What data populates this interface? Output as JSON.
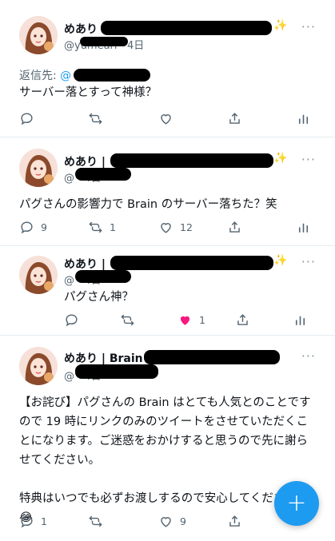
{
  "tweets": [
    {
      "name": "めあり",
      "handle": "@yumeari",
      "time": "4日",
      "reply_label": "返信先:",
      "reply_mention": "@",
      "text": "サーバー落とすって神様？",
      "counts": {
        "reply": "",
        "retweet": "",
        "like": ""
      },
      "liked": false
    },
    {
      "name": "めあり |",
      "handle": "@",
      "time": "4日",
      "text": "パグさんの影響力で Brain のサーバー落ちた？笑",
      "counts": {
        "reply": "9",
        "retweet": "1",
        "like": "12"
      },
      "liked": false
    },
    {
      "name": "めあり |",
      "handle": "@",
      "time": "4日",
      "text": "パグさん神？",
      "counts": {
        "reply": "",
        "retweet": "",
        "like": "1"
      },
      "liked": true
    },
    {
      "name": "めあり | Brain",
      "handle": "@",
      "time": "4日",
      "text": "【お詫び】パグさんの Brain はとても人気とのことですので 19 時にリンクのみのツイートをさせていただくことになります。ご迷惑をおかけすると思うので先に謝らせてください。\n\n特典はいつでも必ずお渡しするので安心してくださいね😂",
      "counts": {
        "reply": "1",
        "retweet": "",
        "like": "9"
      },
      "liked": false
    }
  ],
  "fab": {
    "label": "+"
  },
  "colors": {
    "accent": "#1d9bf0",
    "like": "#f91880",
    "muted": "#536471"
  }
}
